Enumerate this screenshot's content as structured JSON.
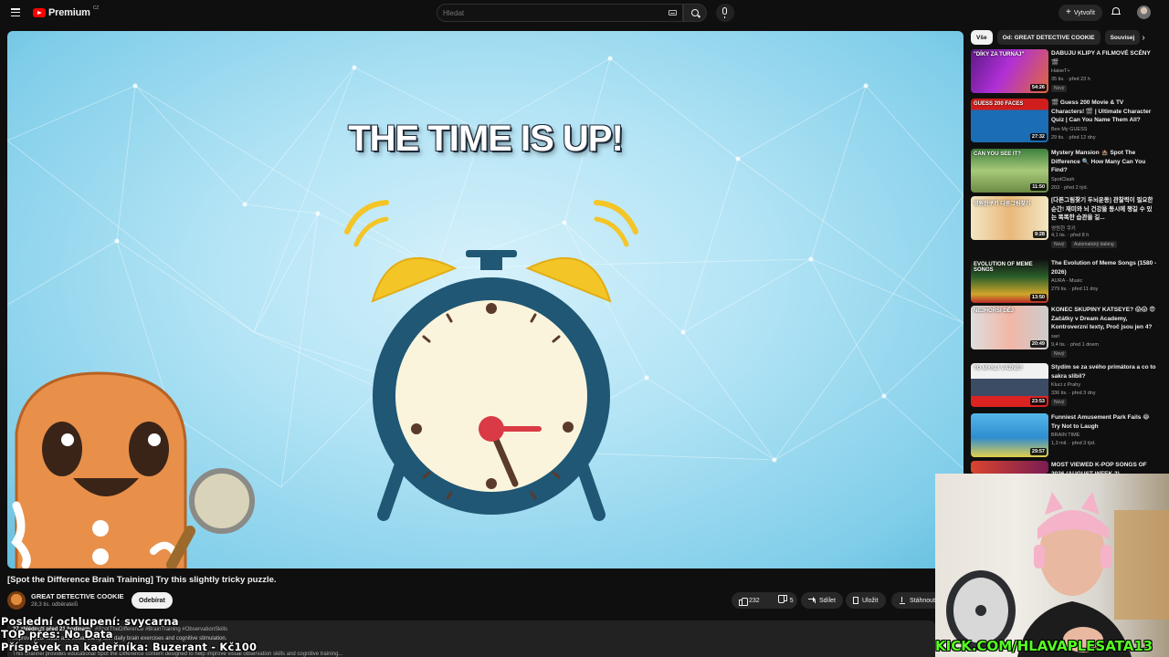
{
  "topbar": {
    "logo_text": "Premium",
    "logo_country": "CZ",
    "search_placeholder": "Hledat",
    "create_label": "Vytvořit"
  },
  "player": {
    "overlay_title": "THE TIME IS UP!"
  },
  "video": {
    "title": "[Spot the Difference Brain Training] Try this slightly tricky puzzle.",
    "channel_name": "GREAT DETECTIVE COOKIE",
    "channel_subs": "28,3 tis. odběratelů",
    "subscribe_label": "Odebírat",
    "likes": "232",
    "dislikes": "5",
    "share_label": "Sdílet",
    "save_label": "Uložit",
    "download_label": "Stáhnout",
    "desc_meta": "27 zhlédnutí před 21 hodinami",
    "desc_tags": "#SpotTheDifference #BrainTraining #ObservationSkills",
    "desc_line1": "Improve your focus and visual clarity with daily brain exercises and cognitive stimulation.",
    "desc_line2": "This channel provides educational Spot the Difference content designed to help improve visual observation skills and cognitive training..."
  },
  "overlays": {
    "line1": "Poslední ochlupení: svycarna",
    "line2": "TOP přes: No Data",
    "line3": "Příspěvek na kadeřníka: Buzerant - Kč100",
    "kick": "KICK.COM/HLAVAPLESATA13"
  },
  "sidebar": {
    "chips": [
      {
        "label": "Vše"
      },
      {
        "label": "Od: GREAT DETECTIVE COOKIE"
      },
      {
        "label": "Souvisej"
      }
    ],
    "recs": [
      {
        "title": "DABUJU KLIPY A FILMOVÉ SCÉNY 🎬",
        "channel": "HaiseT+",
        "stats": "35 tis. · před 23 h",
        "badge": "Nový",
        "duration": "54:26",
        "thumb_text": "\"DÍKY ZA TURNAJ\""
      },
      {
        "title": "🎬 Guess 200 Movie & TV Characters! 🎬 | Ultimate Character Quiz | Can You Name Them All?",
        "channel": "Bee My GUESS",
        "stats": "29 tis. · před 12 dny",
        "badge": "",
        "duration": "27:32",
        "thumb_text": "GUESS 200 FACES"
      },
      {
        "title": "Mystery Mansion 🏚️ Spot The Difference 🔍 How Many Can You Find?",
        "channel": "SpotClash",
        "stats": "203 · před 2 týd.",
        "badge": "",
        "duration": "11:50",
        "thumb_text": "CAN YOU SEE IT?"
      },
      {
        "title": "[다른그림찾기 두뇌운동] 관찰력이 필요한 순간! 재미와 뇌 건강을 동시에 챙길 수 있는 똑똑한 습관을 길...",
        "channel": "영원한 쿠키",
        "stats": "4,1 tis. · před 8 h",
        "badge": "Nový",
        "badge2": "Automatický dabing",
        "duration": "9:28",
        "thumb_text": "영원한쿠키 다른그림찾기"
      },
      {
        "title": "The Evolution of Meme Songs (1580 - 2026)",
        "channel": "AURA - Music",
        "stats": "279 tis. · před 11 dny",
        "badge": "",
        "duration": "13:50",
        "thumb_text": "EVOLUTION OF MEME SONGS"
      },
      {
        "title": "KONEC SKUPINY KATSEYE? 😱😱 😨 Začátky v Dream Academy, Kontroverzní texty, Proč jsou jen 4?",
        "channel": "sari",
        "stats": "9,4 tis. · před 1 dnem",
        "badge": "Nový",
        "duration": "20:49",
        "thumb_text": "NEJHORŠÍ DĚJ"
      },
      {
        "title": "Stydím se za svého primátora a co to sakra slíbil?",
        "channel": "Kluci z Prahy",
        "stats": "336 tis. · před 3 dny",
        "badge": "Nový",
        "duration": "23:53",
        "thumb_text": "TO MYSLÍ VÁŽNĚ?"
      },
      {
        "title": "Funniest Amusement Park Fails 😂 Try Not to Laugh",
        "channel": "BRAIN TIME",
        "stats": "1,3 mil. · před 3 týd.",
        "badge": "",
        "duration": "29:57",
        "thumb_text": ""
      },
      {
        "title": "MOST VIEWED K-POP SONGS OF 2026 (AUGUST WEEK 2)",
        "channel": "",
        "stats": "",
        "badge": "",
        "duration": "",
        "thumb_text": ""
      }
    ]
  },
  "colors": {
    "background": "#0f0f0f",
    "accent_red": "#ff0000",
    "kick_green": "#54ff20",
    "sky": "#b3e4f5"
  }
}
